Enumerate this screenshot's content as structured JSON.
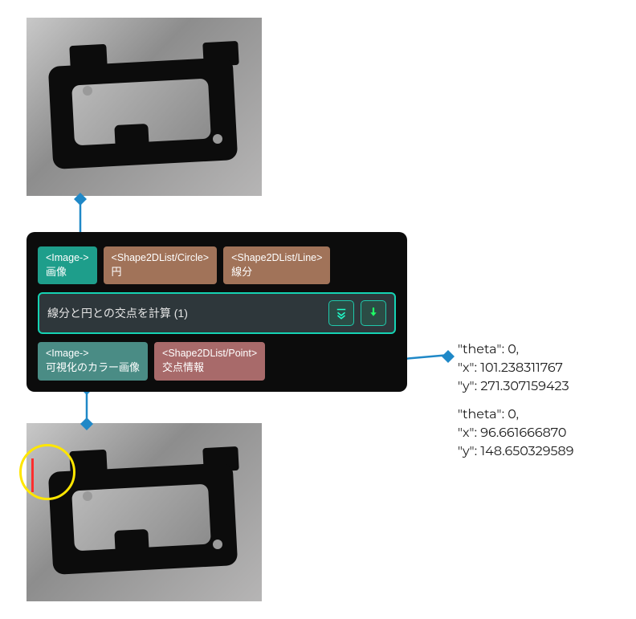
{
  "node": {
    "inputs": [
      {
        "tag": "<Image->",
        "label": "画像",
        "style": "teal"
      },
      {
        "tag": "<Shape2DList/Circle>",
        "label": "円",
        "style": "brown"
      },
      {
        "tag": "<Shape2DList/Line>",
        "label": "線分",
        "style": "brown"
      }
    ],
    "title": "線分と円との交点を計算 (1)",
    "buttons": {
      "expand": "expand-icon",
      "run": "run-icon"
    },
    "outputs": [
      {
        "tag": "<Image->",
        "label": "可視化のカラー画像",
        "style": "teal-dim"
      },
      {
        "tag": "<Shape2DList/Point>",
        "label": "交点情報",
        "style": "rose"
      }
    ]
  },
  "intersection_results": [
    {
      "theta_label": "\"theta\": 0,",
      "x_label": "\"x\": 101.238311767",
      "y_label": "\"y\": 271.307159423"
    },
    {
      "theta_label": "\"theta\": 0,",
      "x_label": "\"x\": 96.661666870",
      "y_label": "\"y\": 148.650329589"
    }
  ],
  "images": {
    "top_alt": "入力グレースケール画像",
    "bottom_alt": "可視化カラー画像（検出円と線分を重畳）"
  }
}
